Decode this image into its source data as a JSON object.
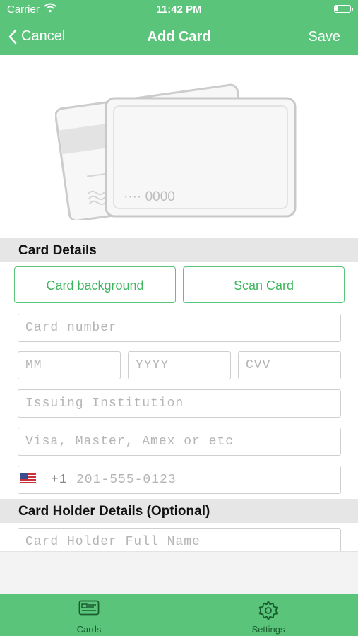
{
  "status_bar": {
    "carrier": "Carrier",
    "time": "11:42 PM"
  },
  "nav": {
    "cancel_label": "Cancel",
    "title": "Add Card",
    "save_label": "Save"
  },
  "card_preview": {
    "number_mask": "···· 0000"
  },
  "card_details": {
    "header": "Card Details",
    "background_button": "Card background",
    "scan_button": "Scan Card",
    "card_number_placeholder": "Card number",
    "month_placeholder": "MM",
    "year_placeholder": "YYYY",
    "cvv_placeholder": "CVV",
    "institution_placeholder": "Issuing Institution",
    "network_placeholder": "Visa, Master, Amex or etc",
    "phone_country_code": "+1",
    "phone_placeholder": "201-555-0123"
  },
  "holder_details": {
    "header": "Card Holder Details (Optional)",
    "full_name_placeholder": "Card Holder Full Name"
  },
  "tabs": [
    {
      "label": "Cards",
      "icon": "card-icon"
    },
    {
      "label": "Settings",
      "icon": "gear-icon"
    }
  ],
  "colors": {
    "accent": "#5ac47a",
    "tab_text": "#1a5c2f",
    "section_bg": "#e6e6e6"
  }
}
